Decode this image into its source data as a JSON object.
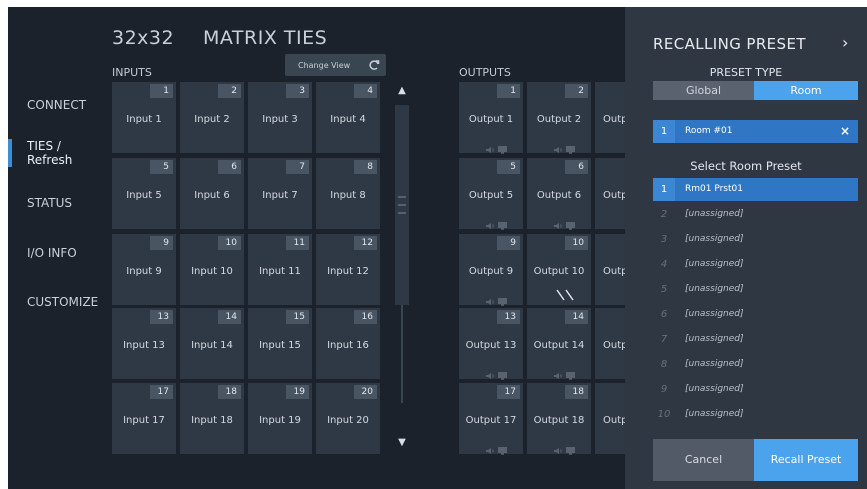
{
  "header": {
    "size": "32x32",
    "title": "MATRIX TIES"
  },
  "nav": [
    {
      "label": "CONNECT"
    },
    {
      "label": "TIES /\nRefresh",
      "active": true
    },
    {
      "label": "STATUS"
    },
    {
      "label": "I/O INFO"
    },
    {
      "label": "CUSTOMIZE"
    }
  ],
  "inputs": {
    "label": "INPUTS",
    "change_view": "Change View",
    "tiles": [
      {
        "num": "1",
        "label": "Input 1"
      },
      {
        "num": "2",
        "label": "Input 2"
      },
      {
        "num": "3",
        "label": "Input 3"
      },
      {
        "num": "4",
        "label": "Input 4"
      },
      {
        "num": "5",
        "label": "Input 5"
      },
      {
        "num": "6",
        "label": "Input 6"
      },
      {
        "num": "7",
        "label": "Input 7"
      },
      {
        "num": "8",
        "label": "Input 8"
      },
      {
        "num": "9",
        "label": "Input 9"
      },
      {
        "num": "10",
        "label": "Input 10"
      },
      {
        "num": "11",
        "label": "Input 11"
      },
      {
        "num": "12",
        "label": "Input 12"
      },
      {
        "num": "13",
        "label": "Input 13"
      },
      {
        "num": "14",
        "label": "Input 14"
      },
      {
        "num": "15",
        "label": "Input 15"
      },
      {
        "num": "16",
        "label": "Input 16"
      },
      {
        "num": "17",
        "label": "Input 17"
      },
      {
        "num": "18",
        "label": "Input 18"
      },
      {
        "num": "19",
        "label": "Input 19"
      },
      {
        "num": "20",
        "label": "Input 20"
      }
    ]
  },
  "outputs": {
    "label": "OUTPUTS",
    "rows": [
      {
        "tiles": [
          {
            "num": "1",
            "label": "Output 1"
          },
          {
            "num": "2",
            "label": "Output 2"
          }
        ],
        "partial": "Outp"
      },
      {
        "tiles": [
          {
            "num": "5",
            "label": "Output 5"
          },
          {
            "num": "6",
            "label": "Output 6"
          }
        ],
        "partial": "Outp"
      },
      {
        "tiles": [
          {
            "num": "9",
            "label": "Output 9"
          },
          {
            "num": "10",
            "label": "Output 10"
          }
        ],
        "partial": "Outp"
      },
      {
        "tiles": [
          {
            "num": "13",
            "label": "Output 13"
          },
          {
            "num": "14",
            "label": "Output 14"
          }
        ],
        "partial": "Outp"
      },
      {
        "tiles": [
          {
            "num": "17",
            "label": "Output 17"
          },
          {
            "num": "18",
            "label": "Output 18"
          }
        ],
        "partial": "Outp"
      }
    ]
  },
  "panel": {
    "title": "RECALLING PRESET",
    "chevron": "›",
    "preset_type_label": "PRESET TYPE",
    "type_global": "Global",
    "type_room": "Room",
    "selected_room": {
      "num": "1",
      "label": "Room #01",
      "clear": "×"
    },
    "select_label": "Select Room Preset",
    "presets": [
      {
        "num": "1",
        "label": "Rm01 Prst01",
        "active": true
      },
      {
        "num": "2",
        "label": "[unassigned]"
      },
      {
        "num": "3",
        "label": "[unassigned]"
      },
      {
        "num": "4",
        "label": "[unassigned]"
      },
      {
        "num": "5",
        "label": "[unassigned]"
      },
      {
        "num": "6",
        "label": "[unassigned]"
      },
      {
        "num": "7",
        "label": "[unassigned]"
      },
      {
        "num": "8",
        "label": "[unassigned]"
      },
      {
        "num": "9",
        "label": "[unassigned]"
      },
      {
        "num": "10",
        "label": "[unassigned]"
      }
    ],
    "cancel": "Cancel",
    "recall": "Recall Preset"
  },
  "colors": {
    "accent": "#3b8ed6",
    "panel": "#2f3742",
    "tile": "#2f3946"
  },
  "icons": {
    "refresh": "refresh-icon",
    "speaker": "speaker-icon",
    "monitor": "monitor-icon"
  }
}
